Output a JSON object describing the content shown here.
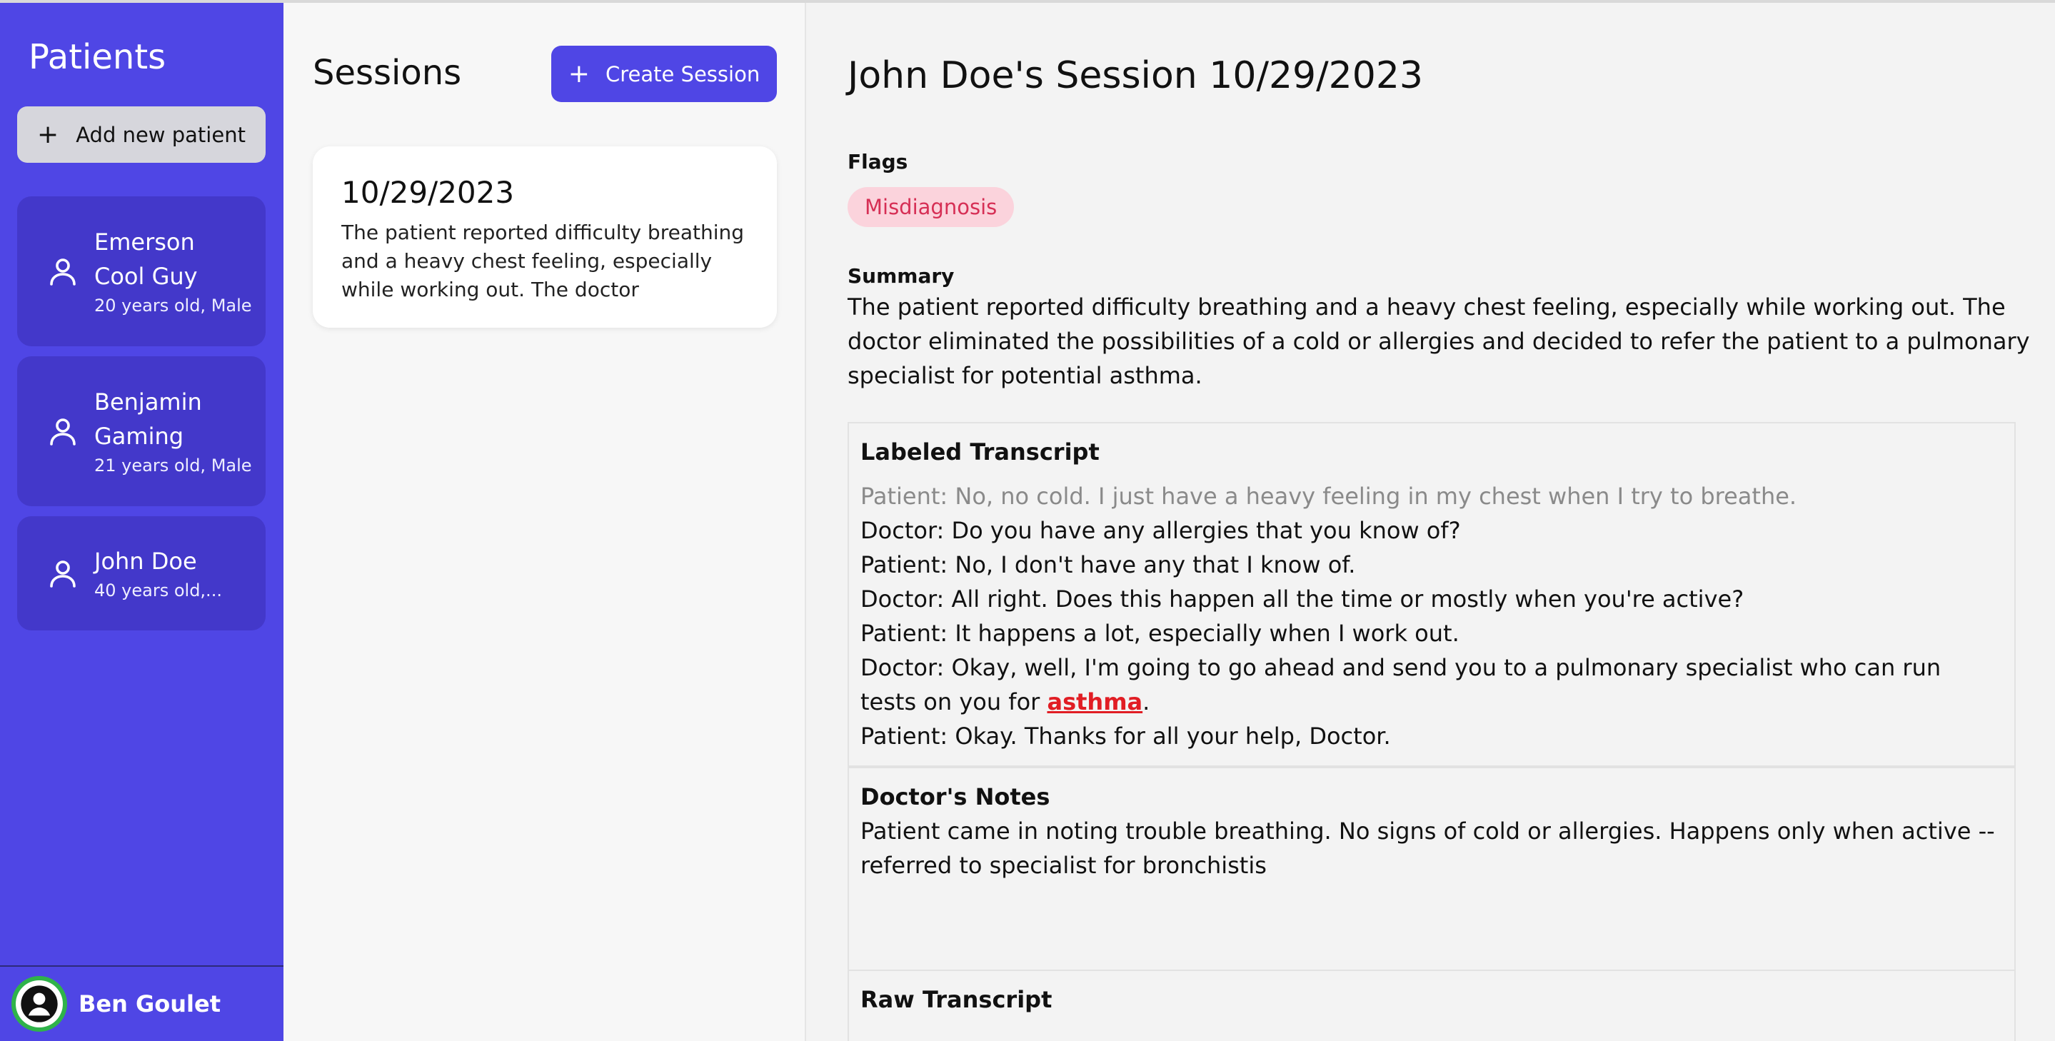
{
  "sidebar": {
    "title": "Patients",
    "add_label": "Add new patient",
    "patients": [
      {
        "name": "Emerson Cool Guy",
        "meta": "20 years old, Male"
      },
      {
        "name": "Benjamin Gaming",
        "meta": "21 years old, Male"
      },
      {
        "name": "John Doe",
        "meta": "40 years old,..."
      }
    ],
    "user": {
      "name": "Ben Goulet"
    }
  },
  "sessions": {
    "title": "Sessions",
    "create_label": "Create Session",
    "items": [
      {
        "date": "10/29/2023",
        "excerpt": "The patient reported difficulty breathing and a heavy chest feeling, especially while working out. The doctor eliminated the..."
      }
    ]
  },
  "detail": {
    "title": "John Doe's Session 10/29/2023",
    "flags_label": "Flags",
    "flags": [
      "Misdiagnosis"
    ],
    "summary_label": "Summary",
    "summary": "The patient reported difficulty breathing and a heavy chest feeling, especially while working out. The doctor eliminated the possibilities of a cold or allergies and decided to refer the patient to a pulmonary specialist for potential asthma.",
    "transcript": {
      "title": "Labeled Transcript",
      "lines": [
        "Patient: No, no cold. I just have a heavy feeling in my chest when I try to breathe.",
        "Doctor: Do you have any allergies that you know of?",
        "Patient: No, I don't have any that I know of.",
        "Doctor: All right. Does this happen all the time or mostly when you're active?",
        "Patient: It happens a lot, especially when I work out."
      ],
      "line6_pre": "Doctor: Okay, well, I'm going to go ahead and send you to a pulmonary specialist who can run tests on you for ",
      "line6_keyword": "asthma",
      "line6_post": ".",
      "line7": "Patient: Okay. Thanks for all your help, Doctor."
    },
    "notes": {
      "title": "Doctor's Notes",
      "body": "Patient came in noting trouble breathing. No signs of cold or allergies. Happens only when active -- referred to specialist for bronchistis"
    },
    "raw": {
      "title": "Raw Transcript"
    }
  },
  "colors": {
    "sidebar": "#4f46e5",
    "patient_card": "#4338ca",
    "flag_bg": "#fbd3dc",
    "flag_text": "#d62f55",
    "keyword": "#e11d24",
    "avatar_ring": "#2fb34a"
  }
}
